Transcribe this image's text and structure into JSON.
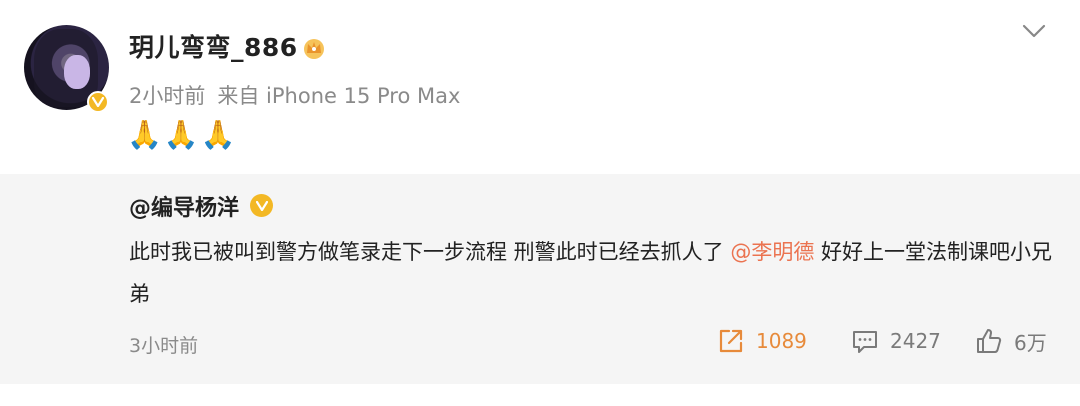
{
  "post": {
    "username": "玥儿弯弯_886",
    "time": "2小时前",
    "source": "来自 iPhone 15 Pro Max",
    "content": "🙏🙏🙏"
  },
  "quote": {
    "author": "@编导杨洋",
    "text_before": "此时我已被叫到警方做笔录走下一步流程 刑警此时已经去抓人了 ",
    "mention": "@李明德",
    "text_after": " 好好上一堂法制课吧小兄弟",
    "time": "3小时前"
  },
  "actions": {
    "repost_count": "1089",
    "comment_count": "2427",
    "like_count": "6万"
  },
  "colors": {
    "accent": "#eb7350",
    "repost": "#e78a3a",
    "vip_badge": "#f3b824",
    "quote_bg": "#f5f5f5"
  }
}
